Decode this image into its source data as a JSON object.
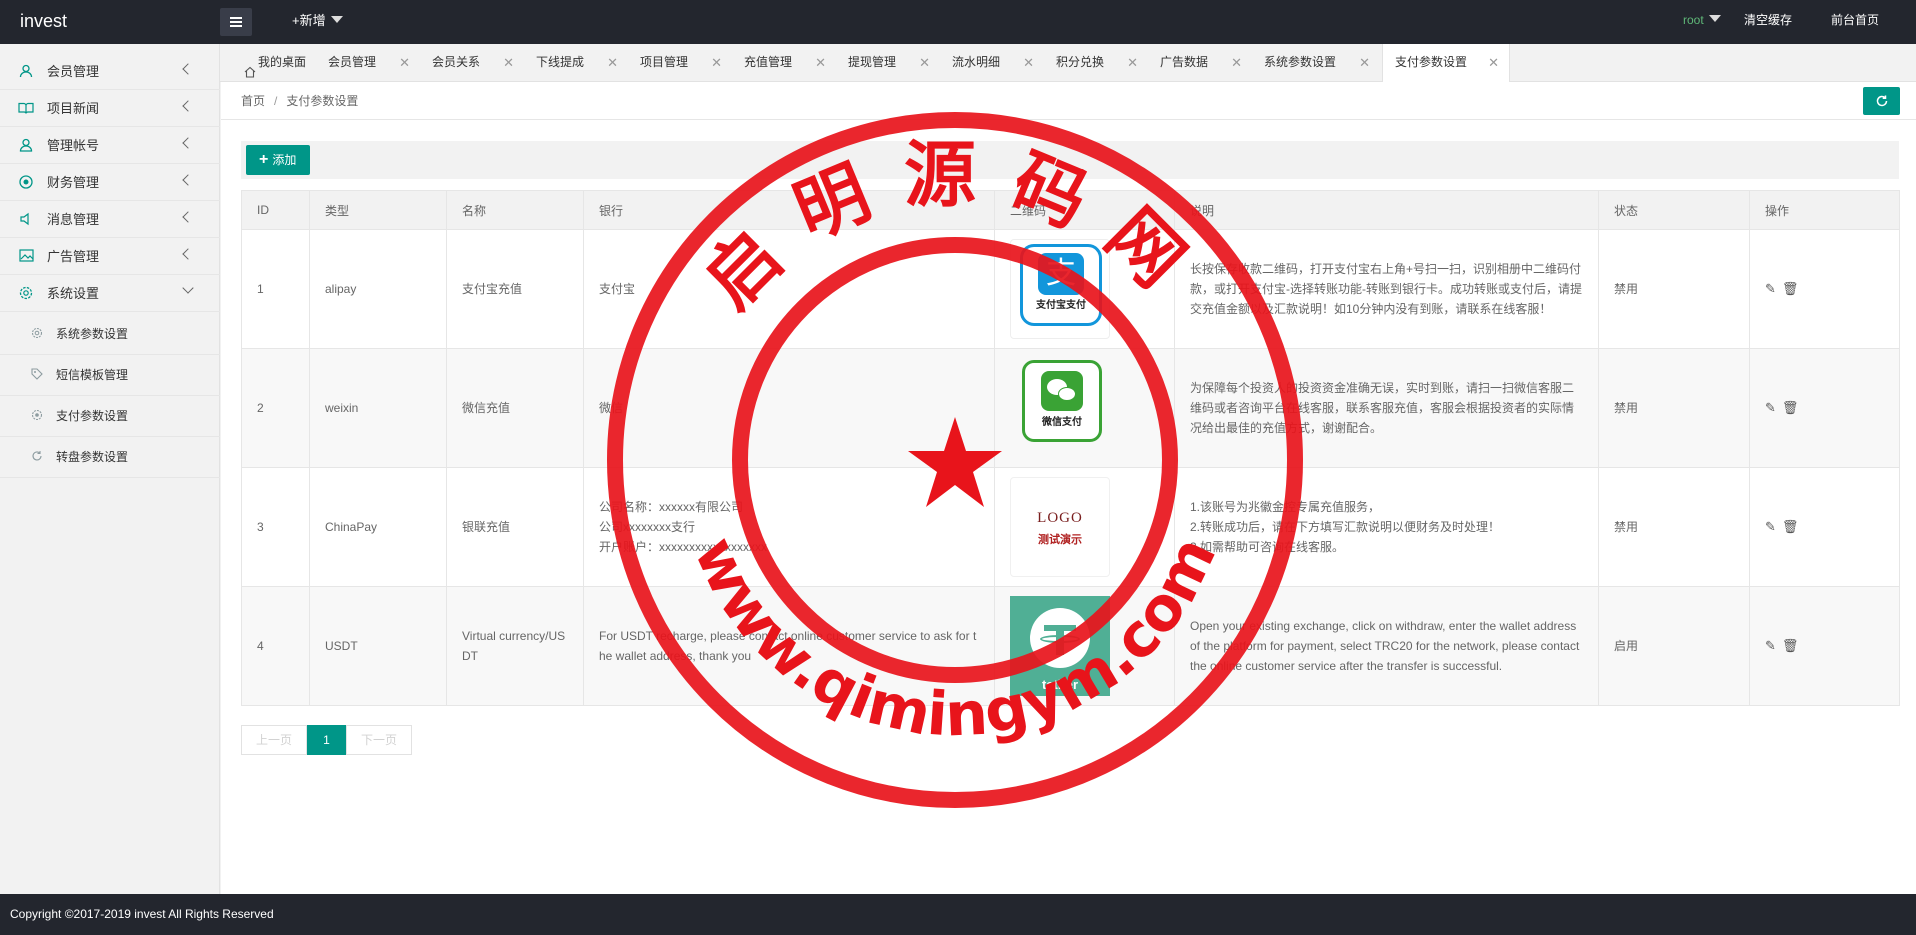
{
  "app": {
    "title": "invest"
  },
  "topbar": {
    "new_label": "+新增",
    "user": "root",
    "clear_cache": "清空缓存",
    "front_home": "前台首页"
  },
  "sidebar": {
    "items": [
      {
        "label": "会员管理",
        "icon": "user-icon"
      },
      {
        "label": "项目新闻",
        "icon": "book-icon"
      },
      {
        "label": "管理帐号",
        "icon": "account-icon"
      },
      {
        "label": "财务管理",
        "icon": "finance-icon"
      },
      {
        "label": "消息管理",
        "icon": "speaker-icon"
      },
      {
        "label": "广告管理",
        "icon": "image-icon"
      },
      {
        "label": "系统设置",
        "icon": "gear-icon"
      }
    ],
    "subitems": [
      {
        "label": "系统参数设置"
      },
      {
        "label": "短信模板管理"
      },
      {
        "label": "支付参数设置"
      },
      {
        "label": "转盘参数设置"
      }
    ]
  },
  "tabs": [
    {
      "label": "我的桌面"
    },
    {
      "label": "会员管理"
    },
    {
      "label": "会员关系"
    },
    {
      "label": "下线提成"
    },
    {
      "label": "项目管理"
    },
    {
      "label": "充值管理"
    },
    {
      "label": "提现管理"
    },
    {
      "label": "流水明细"
    },
    {
      "label": "积分兑换"
    },
    {
      "label": "广告数据"
    },
    {
      "label": "系统参数设置"
    },
    {
      "label": "支付参数设置"
    }
  ],
  "breadcrumb": {
    "home": "首页",
    "sep": "/",
    "current": "支付参数设置"
  },
  "toolbar": {
    "add_label": "添加"
  },
  "table": {
    "headers": [
      "ID",
      "类型",
      "名称",
      "银行",
      "二维码",
      "说明",
      "状态",
      "操作"
    ],
    "rows": [
      {
        "id": "1",
        "type": "alipay",
        "name": "支付宝充值",
        "bank": "支付宝",
        "qr_label": "支付宝支付",
        "desc": "长按保存收款二维码，打开支付宝右上角+号扫一扫，识别相册中二维码付款，或打开支付宝-选择转账功能-转账到银行卡。成功转账或支付后，请提交充值金额以及汇款说明！如10分钟内没有到账，请联系在线客服！",
        "status": "禁用"
      },
      {
        "id": "2",
        "type": "weixin",
        "name": "微信充值",
        "bank": "微信",
        "qr_label": "微信支付",
        "desc": "为保障每个投资人的投资资金准确无误，实时到账，请扫一扫微信客服二维码或者咨询平台在线客服，联系客服充值，客服会根据投资者的实际情况给出最佳的充值方式，谢谢配合。",
        "status": "禁用"
      },
      {
        "id": "3",
        "type": "ChinaPay",
        "name": "银联充值",
        "bank_lines": [
          "公司名称：xxxxxx有限公司",
          "公司xxxxxxxx支行",
          "开户账户：xxxxxxxxxxxxxxxxxx"
        ],
        "qr_logo": "LOGO",
        "qr_sub": "测试演示",
        "desc_lines": [
          "1.该账号为兆徽金控专属充值服务，",
          "2.转账成功后，请在下方填写汇款说明以便财务及时处理！",
          "3.如需帮助可咨询在线客服。"
        ],
        "status": "禁用"
      },
      {
        "id": "4",
        "type": "USDT",
        "name": "Virtual currency/USDT",
        "bank": "For USDT recharge, please contact online customer service to ask for the wallet address, thank you",
        "qr_label": "tether",
        "desc": "Open your existing exchange, click on withdraw, enter the wallet address of the platform for payment, select TRC20 for the network, please contact the online customer service after the transfer is successful.",
        "status": "启用"
      }
    ]
  },
  "pager": {
    "prev": "上一页",
    "current": "1",
    "next": "下一页"
  },
  "footer": {
    "copyright": "Copyright ©2017-2019 invest All Rights Reserved"
  },
  "watermark": {
    "title": "启明源码网",
    "url": "www.qimingym.com",
    "color": "#e8141b"
  },
  "colors": {
    "accent": "#009688",
    "dark": "#23262e",
    "alipay": "#1296db",
    "wechat": "#3aa335",
    "tether": "#50af95"
  }
}
